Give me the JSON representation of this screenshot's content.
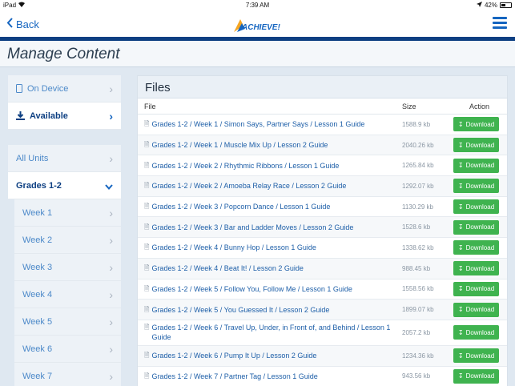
{
  "status": {
    "carrier": "iPad",
    "time": "7:39 AM",
    "battery": "42%",
    "battery_level": 0.42
  },
  "nav": {
    "back_label": "Back",
    "logo_text": "ACHIEVE!"
  },
  "page": {
    "title": "Manage Content"
  },
  "sidebar": {
    "device_items": [
      {
        "label": "On Device",
        "icon": "tablet-icon",
        "state": "dim"
      },
      {
        "label": "Available",
        "icon": "download-icon",
        "state": "active"
      }
    ],
    "unit_items": [
      {
        "label": "All Units",
        "state": "dim"
      },
      {
        "label": "Grades 1-2",
        "state": "active"
      },
      {
        "label": "Week 1",
        "state": "sub"
      },
      {
        "label": "Week 2",
        "state": "sub"
      },
      {
        "label": "Week 3",
        "state": "sub"
      },
      {
        "label": "Week 4",
        "state": "sub"
      },
      {
        "label": "Week 5",
        "state": "sub"
      },
      {
        "label": "Week 6",
        "state": "sub"
      },
      {
        "label": "Week 7",
        "state": "sub"
      }
    ]
  },
  "files": {
    "title": "Files",
    "columns": {
      "file": "File",
      "size": "Size",
      "action": "Action"
    },
    "download_label": "Download",
    "rows": [
      {
        "name": "Grades 1-2 / Week 1 / Simon Says, Partner Says / Lesson 1 Guide",
        "size": "1588.9 kb"
      },
      {
        "name": "Grades 1-2 / Week 1 / Muscle Mix Up / Lesson 2 Guide",
        "size": "2040.26 kb"
      },
      {
        "name": "Grades 1-2 / Week 2 / Rhythmic Ribbons / Lesson 1 Guide",
        "size": "1265.84 kb"
      },
      {
        "name": "Grades 1-2 / Week 2 / Amoeba Relay Race / Lesson 2 Guide",
        "size": "1292.07 kb"
      },
      {
        "name": "Grades 1-2 / Week 3 / Popcorn Dance / Lesson 1 Guide",
        "size": "1130.29 kb"
      },
      {
        "name": "Grades 1-2 / Week 3 / Bar and Ladder Moves / Lesson 2 Guide",
        "size": "1528.6 kb"
      },
      {
        "name": "Grades 1-2 / Week 4 / Bunny Hop / Lesson 1 Guide",
        "size": "1338.62 kb"
      },
      {
        "name": "Grades 1-2 / Week 4 / Beat It! / Lesson 2 Guide",
        "size": "988.45 kb"
      },
      {
        "name": "Grades 1-2 / Week 5 / Follow You, Follow Me / Lesson 1 Guide",
        "size": "1558.56 kb"
      },
      {
        "name": "Grades 1-2 / Week 5 / You Guessed It / Lesson 2 Guide",
        "size": "1899.07 kb"
      },
      {
        "name": "Grades 1-2 / Week 6 / Travel Up, Under, in Front of, and Behind / Lesson 1 Guide",
        "size": "2057.2 kb"
      },
      {
        "name": "Grades 1-2 / Week 6 / Pump It Up / Lesson 2 Guide",
        "size": "1234.36 kb"
      },
      {
        "name": "Grades 1-2 / Week 7 / Partner Tag / Lesson 1 Guide",
        "size": "943.56 kb"
      }
    ]
  },
  "colors": {
    "accent": "#1565c0",
    "nav_line": "#0d3f82",
    "download": "#3fb34f"
  }
}
